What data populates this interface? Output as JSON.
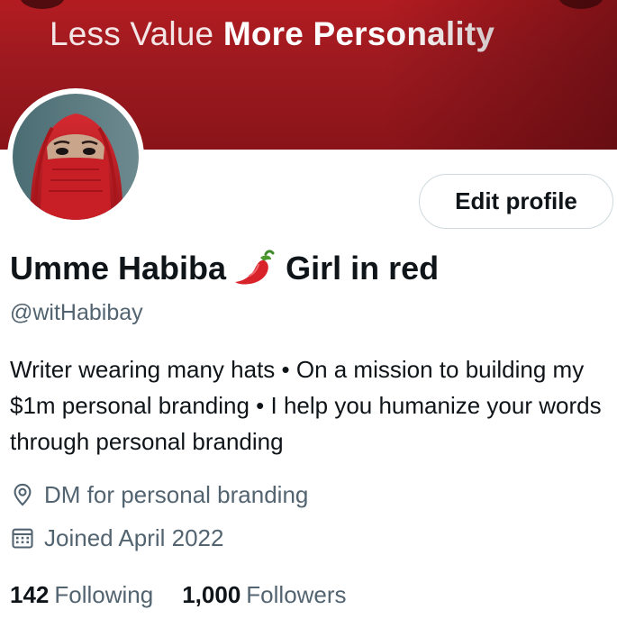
{
  "banner": {
    "text_light": "Less Value",
    "text_bold": "More Personality",
    "color": "#9d1a20"
  },
  "profile": {
    "avatar": "profile-photo",
    "edit_button_label": "Edit profile",
    "name_first": "Umme Habiba",
    "name_emoji": "chili-pepper-icon",
    "name_rest": "Girl in red",
    "handle": "@witHabibay",
    "bio": "Writer wearing many hats • On a mission to building my $1m personal branding • I help you humanize your words through personal branding",
    "location": "DM for personal branding",
    "location_icon": "location-pin-icon",
    "joined": "Joined April 2022",
    "joined_icon": "calendar-icon"
  },
  "stats": {
    "following_count": "142",
    "following_label": "Following",
    "followers_count": "1,000",
    "followers_label": "Followers"
  }
}
